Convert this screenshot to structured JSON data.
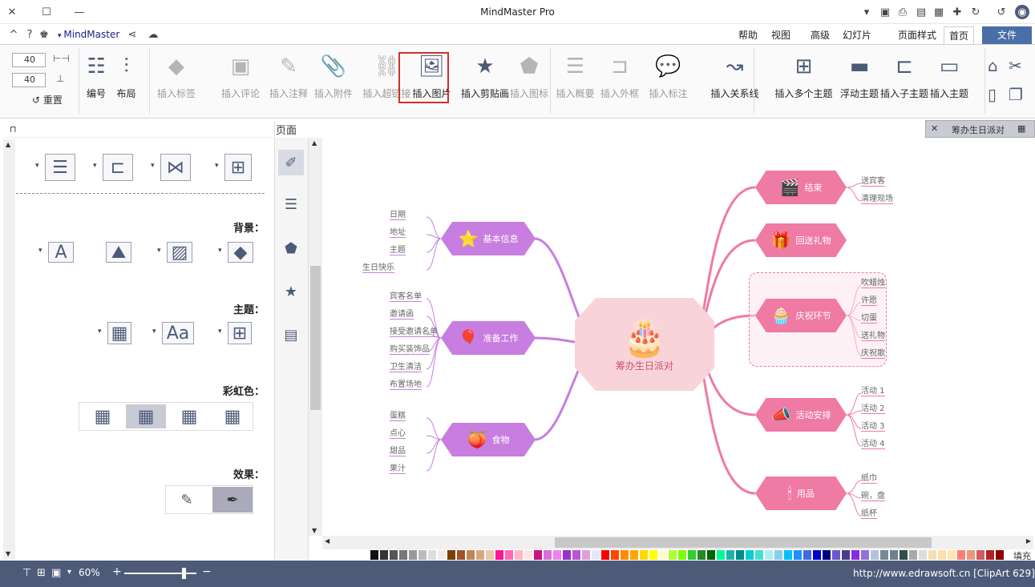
{
  "window": {
    "title": "MindMaster Pro",
    "brand": "MindMaster"
  },
  "menu": {
    "tabs": [
      "文件",
      "首页",
      "页面样式",
      "幻灯片",
      "高级",
      "视图",
      "帮助"
    ]
  },
  "ribbon": {
    "buttons": [
      {
        "label": "插入主题",
        "enabled": true
      },
      {
        "label": "插入子主题",
        "enabled": true
      },
      {
        "label": "浮动主题",
        "enabled": true
      },
      {
        "label": "插入多个主题",
        "enabled": true
      },
      {
        "label": "插入关系线",
        "enabled": true
      },
      {
        "label": "插入标注",
        "enabled": false
      },
      {
        "label": "插入外框",
        "enabled": false
      },
      {
        "label": "插入概要",
        "enabled": false
      },
      {
        "label": "插入图标",
        "enabled": false
      },
      {
        "label": "插入剪贴画",
        "enabled": true
      },
      {
        "label": "插入图片",
        "enabled": true
      },
      {
        "label": "插入超链接",
        "enabled": false
      },
      {
        "label": "插入附件",
        "enabled": false
      },
      {
        "label": "插入注释",
        "enabled": false
      },
      {
        "label": "插入评论",
        "enabled": false
      },
      {
        "label": "插入标签",
        "enabled": false
      },
      {
        "label": "布局",
        "enabled": true
      },
      {
        "label": "编号",
        "enabled": true
      }
    ],
    "spin1": "40",
    "spin2": "40",
    "reset": "重置"
  },
  "panel": {
    "title": "页面",
    "sections": {
      "background": "背景：",
      "theme": "主题：",
      "rainbow": "彩虹色：",
      "effect": "效果："
    }
  },
  "doc_tab": {
    "label": "筹办生日派对"
  },
  "map": {
    "center": "筹办生日派对",
    "left": [
      {
        "label": "基本信息",
        "leaves": [
          "日期",
          "地址",
          "主题",
          "生日快乐"
        ]
      },
      {
        "label": "准备工作",
        "leaves": [
          "宾客名单",
          "邀请函",
          "接受邀请名单",
          "购买装饰品",
          "卫生清洁",
          "布置场地"
        ]
      },
      {
        "label": "食物",
        "leaves": [
          "蛋糕",
          "点心",
          "甜品",
          "果汁"
        ]
      }
    ],
    "right": [
      {
        "label": "结束",
        "leaves": [
          "送宾客",
          "清理现场"
        ]
      },
      {
        "label": "回送礼物",
        "leaves": []
      },
      {
        "label": "庆祝环节",
        "leaves": [
          "吹蜡烛",
          "许愿",
          "切蛋",
          "送礼物",
          "庆祝歌"
        ]
      },
      {
        "label": "活动安排",
        "leaves": [
          "活动 1",
          "活动 2",
          "活动 3",
          "活动 4"
        ]
      },
      {
        "label": "用品",
        "leaves": [
          "纸巾",
          "碗，盘",
          "纸杯"
        ]
      }
    ]
  },
  "fill_label": "填充",
  "status": {
    "zoom": "60%",
    "url": "http://www.edrawsoft.cn [ClipArt 629]"
  },
  "colors": {
    "accent": "#4e5b78",
    "highlight": "#d32f2f",
    "pink": "#ef7aa3",
    "purple": "#c77ee0"
  }
}
